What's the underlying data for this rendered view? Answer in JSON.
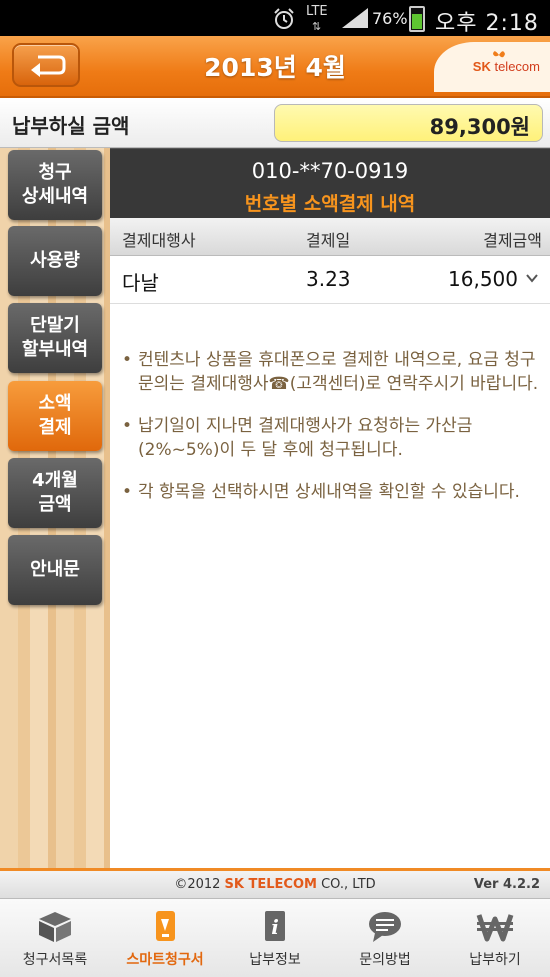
{
  "status_bar": {
    "network": "LTE",
    "battery": "76%",
    "ampm": "오후",
    "time": "2:18"
  },
  "header": {
    "title": "2013년 4월",
    "brand_sk": "SK",
    "brand_telecom": "telecom"
  },
  "amount": {
    "label": "납부하실 금액",
    "value": "89,300원"
  },
  "sidebar": {
    "items": [
      {
        "line1": "청구",
        "line2": "상세내역",
        "active": false
      },
      {
        "line1": "사용량",
        "line2": "",
        "active": false
      },
      {
        "line1": "단말기",
        "line2": "할부내역",
        "active": false
      },
      {
        "line1": "소액",
        "line2": "결제",
        "active": true
      },
      {
        "line1": "4개월",
        "line2": "금액",
        "active": false
      },
      {
        "line1": "안내문",
        "line2": "",
        "active": false
      }
    ]
  },
  "detail": {
    "phone": "010-**70-0919",
    "subtitle": "번호별 소액결제 내역",
    "columns": [
      "결제대행사",
      "결제일",
      "결제금액"
    ],
    "rows": [
      {
        "agent": "다날",
        "date": "3.23",
        "amount": "16,500"
      }
    ],
    "notes": [
      "컨텐츠나 상품을 휴대폰으로 결제한 내역으로, 요금 청구 문의는 결제대행사☎(고객센터)로 연락주시기 바랍니다.",
      "납기일이 지나면 결제대행사가 요청하는 가산금(2%~5%)이 두 달 후에 청구됩니다.",
      "각 항목을 선택하시면 상세내역을 확인할 수 있습니다."
    ]
  },
  "footer": {
    "copyright_prefix": "©2012 ",
    "copyright_brand": "SK TELECOM",
    "copyright_suffix": " CO., LTD",
    "version": "Ver 4.2.2"
  },
  "tabs": [
    {
      "label": "청구서목록",
      "icon": "box-icon",
      "active": false
    },
    {
      "label": "스마트청구서",
      "icon": "smart-bill-icon",
      "active": true
    },
    {
      "label": "납부정보",
      "icon": "info-icon",
      "active": false
    },
    {
      "label": "문의방법",
      "icon": "speech-bubble-icon",
      "active": false
    },
    {
      "label": "납부하기",
      "icon": "won-icon",
      "active": false
    }
  ],
  "colors": {
    "accent_orange": "#ef7b16",
    "amount_yellow": "#fff17a",
    "note_brown": "#7a6240"
  }
}
